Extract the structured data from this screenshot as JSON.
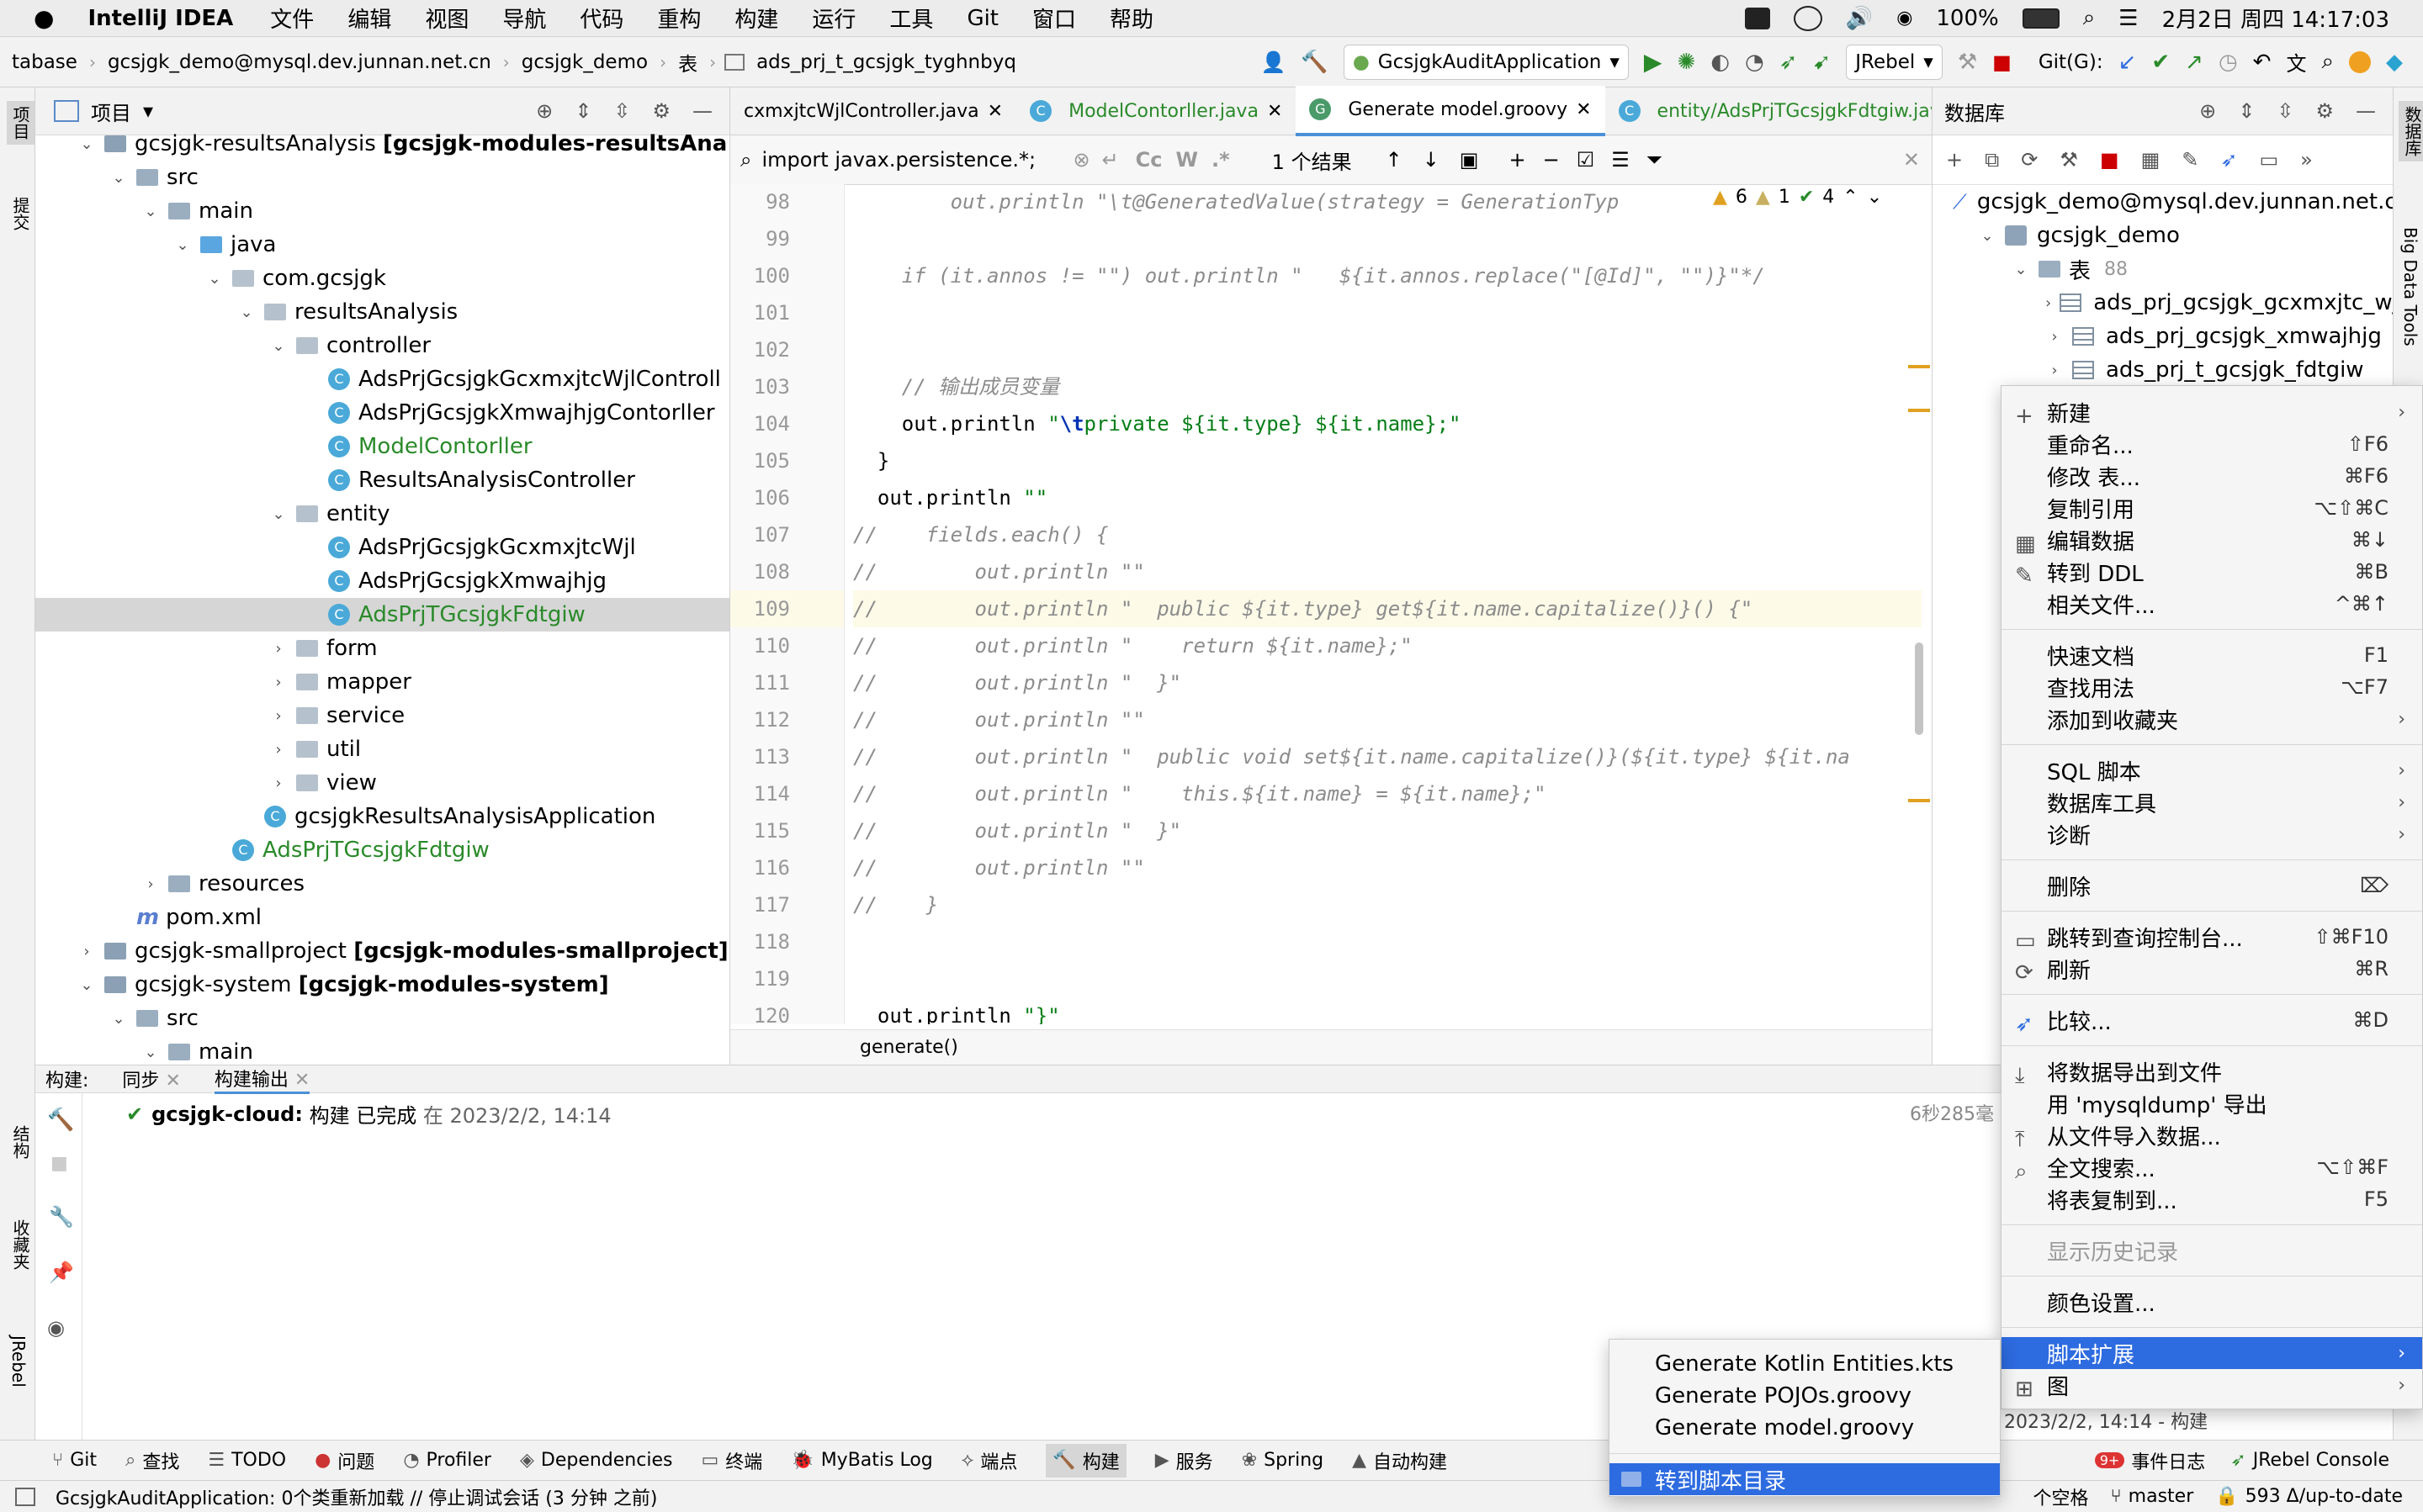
{
  "menubar": {
    "app": "IntelliJ IDEA",
    "items": [
      "文件",
      "编辑",
      "视图",
      "导航",
      "代码",
      "重构",
      "构建",
      "运行",
      "工具",
      "Git",
      "窗口",
      "帮助"
    ],
    "battery": "100%",
    "datetime": "2月2日 周四  14:17:03"
  },
  "navbar": {
    "crumbs": [
      "tabase",
      "gcsjgk_demo@mysql.dev.junnan.net.cn",
      "gcsjgk_demo",
      "表",
      "ads_prj_t_gcsjgk_tyghnbyq"
    ],
    "run_config": "GcsjgkAuditApplication",
    "jrebel": "JRebel",
    "git_label": "Git(G):"
  },
  "left_strip": {
    "top_label": "项目",
    "commit_label": "提交",
    "structure_label": "结构",
    "favorites_label": "收藏夹",
    "jrebel_label": "JRebel"
  },
  "project": {
    "title": "项目",
    "rows": [
      {
        "indent": 0,
        "arrow": "v",
        "icon": "module",
        "text": "gcsjgk-resultsAnalysis ",
        "bold": "[gcsjgk-modules-resultsAna"
      },
      {
        "indent": 1,
        "arrow": "v",
        "icon": "folder",
        "text": "src"
      },
      {
        "indent": 2,
        "arrow": "v",
        "icon": "folder",
        "text": "main"
      },
      {
        "indent": 3,
        "arrow": "v",
        "icon": "folder-blue",
        "text": "java"
      },
      {
        "indent": 4,
        "arrow": "v",
        "icon": "package",
        "text": "com.gcsjgk"
      },
      {
        "indent": 5,
        "arrow": "v",
        "icon": "package",
        "text": "resultsAnalysis"
      },
      {
        "indent": 6,
        "arrow": "v",
        "icon": "package",
        "text": "controller"
      },
      {
        "indent": 7,
        "arrow": "",
        "icon": "class",
        "text": "AdsPrjGcsjgkGcxmxjtcWjlControll"
      },
      {
        "indent": 7,
        "arrow": "",
        "icon": "class",
        "text": "AdsPrjGcsjgkXmwajhjgContorller"
      },
      {
        "indent": 7,
        "arrow": "",
        "icon": "class",
        "text": "ModelContorller",
        "green": true
      },
      {
        "indent": 7,
        "arrow": "",
        "icon": "class",
        "text": "ResultsAnalysisController"
      },
      {
        "indent": 6,
        "arrow": "v",
        "icon": "package",
        "text": "entity"
      },
      {
        "indent": 7,
        "arrow": "",
        "icon": "class",
        "text": "AdsPrjGcsjgkGcxmxjtcWjl"
      },
      {
        "indent": 7,
        "arrow": "",
        "icon": "class",
        "text": "AdsPrjGcsjgkXmwajhjg"
      },
      {
        "indent": 7,
        "arrow": "",
        "icon": "class",
        "text": "AdsPrjTGcsjgkFdtgiw",
        "green": true,
        "selected": true
      },
      {
        "indent": 6,
        "arrow": ">",
        "icon": "package",
        "text": "form"
      },
      {
        "indent": 6,
        "arrow": ">",
        "icon": "package",
        "text": "mapper"
      },
      {
        "indent": 6,
        "arrow": ">",
        "icon": "package",
        "text": "service"
      },
      {
        "indent": 6,
        "arrow": ">",
        "icon": "package",
        "text": "util"
      },
      {
        "indent": 6,
        "arrow": ">",
        "icon": "package",
        "text": "view"
      },
      {
        "indent": 5,
        "arrow": "",
        "icon": "class",
        "text": "gcsjgkResultsAnalysisApplication"
      },
      {
        "indent": 4,
        "arrow": "",
        "icon": "class",
        "text": "AdsPrjTGcsjgkFdtgiw",
        "green": true
      },
      {
        "indent": 2,
        "arrow": ">",
        "icon": "folder",
        "text": "resources"
      },
      {
        "indent": 1,
        "arrow": "",
        "icon": "maven",
        "text": "pom.xml"
      },
      {
        "indent": 0,
        "arrow": ">",
        "icon": "module",
        "text": "gcsjgk-smallproject ",
        "bold": "[gcsjgk-modules-smallproject]"
      },
      {
        "indent": 0,
        "arrow": "v",
        "icon": "module",
        "text": "gcsjgk-system ",
        "bold": "[gcsjgk-modules-system]"
      },
      {
        "indent": 1,
        "arrow": "v",
        "icon": "folder",
        "text": "src"
      },
      {
        "indent": 2,
        "arrow": "v",
        "icon": "folder",
        "text": "main"
      }
    ]
  },
  "editor": {
    "tabs": [
      {
        "label": "cxmxjtcWjlController.java",
        "icon": "",
        "active": false
      },
      {
        "label": "ModelContorller.java",
        "icon": "C",
        "active": false,
        "green": true
      },
      {
        "label": "Generate model.groovy",
        "icon": "G",
        "active": true
      },
      {
        "label": "entity/AdsPrjTGcsjgkFdtgiw.java",
        "icon": "C",
        "active": false,
        "green": true
      }
    ],
    "find_text": "import javax.persistence.*;",
    "find_result": "1 个结果",
    "inspect": {
      "warn": "6",
      "weak": "1",
      "ok": "4"
    },
    "breadcrumb": "generate()",
    "lines": [
      {
        "n": "98",
        "html": "<span class=\"cmt\">        out.println \"\\t@GeneratedValue(strategy = GenerationTyp</span>"
      },
      {
        "n": "99",
        "html": ""
      },
      {
        "n": "100",
        "html": "<span class=\"cmt\">    if (it.annos != \"\") out.println \"   ${it.annos.replace(\"[@Id]\", \"\")}\"*/</span>"
      },
      {
        "n": "101",
        "html": ""
      },
      {
        "n": "102",
        "html": ""
      },
      {
        "n": "103",
        "html": "<span class=\"cmt\">    // 输出成员变量</span>"
      },
      {
        "n": "104",
        "html": "    out.println <span class=\"str\">\"</span><span class=\"kw\">\\t</span><span class=\"str\">private ${it.type} ${it.name};\"</span>"
      },
      {
        "n": "105",
        "html": "  }"
      },
      {
        "n": "106",
        "html": "  out.println <span class=\"str\">\"\"</span>"
      },
      {
        "n": "107",
        "html": "<span class=\"cmt\">//    fields.each() {</span>"
      },
      {
        "n": "108",
        "html": "<span class=\"cmt\">//        out.println \"\"</span>"
      },
      {
        "n": "109",
        "html": "<span class=\"cmt\">//        out.println \"  public ${it.type} get${it.name.capitalize()}() {\"</span>",
        "current": true
      },
      {
        "n": "110",
        "html": "<span class=\"cmt\">//        out.println \"    return ${it.name};\"</span>"
      },
      {
        "n": "111",
        "html": "<span class=\"cmt\">//        out.println \"  }\"</span>"
      },
      {
        "n": "112",
        "html": "<span class=\"cmt\">//        out.println \"\"</span>"
      },
      {
        "n": "113",
        "html": "<span class=\"cmt\">//        out.println \"  public void set${it.name.capitalize()}(${it.type} ${it.na</span>"
      },
      {
        "n": "114",
        "html": "<span class=\"cmt\">//        out.println \"    this.${it.name} = ${it.name};\"</span>"
      },
      {
        "n": "115",
        "html": "<span class=\"cmt\">//        out.println \"  }\"</span>"
      },
      {
        "n": "116",
        "html": "<span class=\"cmt\">//        out.println \"\"</span>"
      },
      {
        "n": "117",
        "html": "<span class=\"cmt\">//    }</span>"
      },
      {
        "n": "118",
        "html": ""
      },
      {
        "n": "119",
        "html": ""
      },
      {
        "n": "120",
        "html": "  out.println <span class=\"str\">\"}\"</span>"
      }
    ]
  },
  "database": {
    "title": "数据库",
    "rows": [
      {
        "indent": 0,
        "arrow": "",
        "icon": "db-conn",
        "text": "gcsjgk_demo@mysql.dev.junnan.net.c"
      },
      {
        "indent": 1,
        "arrow": "v",
        "icon": "schema",
        "text": "gcsjgk_demo"
      },
      {
        "indent": 2,
        "arrow": "v",
        "icon": "folder",
        "text": "表",
        "count": "88"
      },
      {
        "indent": 3,
        "arrow": ">",
        "icon": "table",
        "text": "ads_prj_gcsjgk_gcxmxjtc_wjl"
      },
      {
        "indent": 3,
        "arrow": ">",
        "icon": "table",
        "text": "ads_prj_gcsjgk_xmwajhjg"
      },
      {
        "indent": 3,
        "arrow": ">",
        "icon": "table",
        "text": "ads_prj_t_gcsjgk_fdtgiw"
      }
    ],
    "side_label": "Big Data Tools"
  },
  "bottom": {
    "tabs": [
      "构建:",
      "同步",
      "构建输出"
    ],
    "build_project": "gcsjgk-cloud:",
    "build_msg": " 构建 已完成 ",
    "build_at": "在 2023/2/2, 14:14",
    "build_time": "6秒285毫",
    "log_hint": "2023/2/2, 14:14 - 构建"
  },
  "toolwindows": [
    "Git",
    "查找",
    "TODO",
    "问题",
    "Profiler",
    "Dependencies",
    "终端",
    "MyBatis Log",
    "端点",
    "构建",
    "服务",
    "Spring",
    "自动构建"
  ],
  "toolwindows_right": [
    "事件日志",
    "JRebel Console"
  ],
  "event_badge": "9+",
  "status": {
    "left": "GcsjgkAuditApplication: 0个类重新加载 // 停止调试会话 (3 分钟 之前)",
    "indent": "个空格",
    "branch": "master",
    "vcs": "593 Δ/up-to-date"
  },
  "context_menu": {
    "groups": [
      [
        {
          "label": "新建",
          "sub": true,
          "icon": "plus"
        },
        {
          "label": "重命名...",
          "shortcut": "⇧F6"
        },
        {
          "label": "修改 表...",
          "shortcut": "⌘F6"
        },
        {
          "label": "复制引用",
          "shortcut": "⌥⇧⌘C"
        },
        {
          "label": "编辑数据",
          "shortcut": "⌘↓",
          "icon": "grid"
        },
        {
          "label": "转到 DDL",
          "shortcut": "⌘B",
          "icon": "pencil"
        },
        {
          "label": "相关文件...",
          "shortcut": "^⌘↑"
        }
      ],
      [
        {
          "label": "快速文档",
          "shortcut": "F1"
        },
        {
          "label": "查找用法",
          "shortcut": "⌥F7"
        },
        {
          "label": "添加到收藏夹",
          "sub": true
        }
      ],
      [
        {
          "label": "SQL 脚本",
          "sub": true
        },
        {
          "label": "数据库工具",
          "sub": true
        },
        {
          "label": "诊断",
          "sub": true
        }
      ],
      [
        {
          "label": "删除",
          "shortcut": "⌦"
        }
      ],
      [
        {
          "label": "跳转到查询控制台...",
          "shortcut": "⇧⌘F10",
          "icon": "console"
        },
        {
          "label": "刷新",
          "shortcut": "⌘R",
          "icon": "refresh"
        }
      ],
      [
        {
          "label": "比较...",
          "shortcut": "⌘D",
          "icon": "compare"
        }
      ],
      [
        {
          "label": "将数据导出到文件",
          "icon": "export"
        },
        {
          "label": "用 'mysqldump' 导出"
        },
        {
          "label": "从文件导入数据...",
          "icon": "import"
        },
        {
          "label": "全文搜索...",
          "shortcut": "⌥⇧⌘F",
          "icon": "search"
        },
        {
          "label": "将表复制到...",
          "shortcut": "F5"
        }
      ],
      [
        {
          "label": "显示历史记录",
          "disabled": true
        }
      ],
      [
        {
          "label": "颜色设置..."
        }
      ],
      [
        {
          "label": "脚本扩展",
          "sub": true,
          "highlight": true
        },
        {
          "label": "图",
          "sub": true,
          "icon": "diagram"
        }
      ]
    ]
  },
  "submenu": {
    "items": [
      {
        "label": "Generate Kotlin Entities.kts"
      },
      {
        "label": "Generate POJOs.groovy"
      },
      {
        "label": "Generate model.groovy"
      }
    ],
    "footer": {
      "label": "转到脚本目录",
      "highlight": true,
      "icon": "folder"
    }
  }
}
